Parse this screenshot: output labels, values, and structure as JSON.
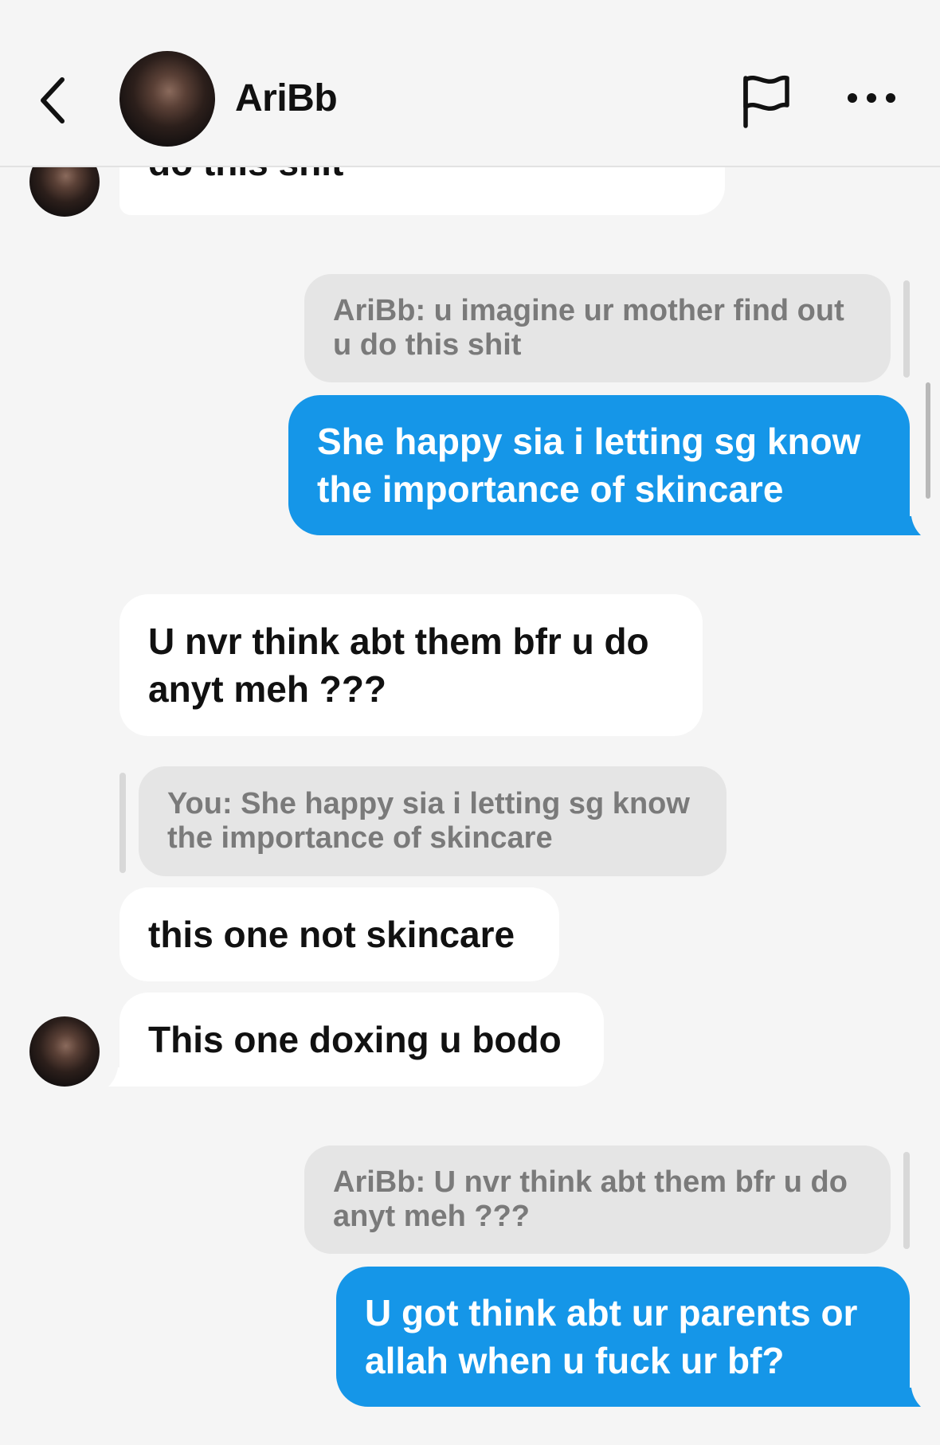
{
  "header": {
    "contact_name": "AriBb",
    "back_icon": "chevron-left-icon",
    "report_icon": "flag-icon",
    "more_icon": "ellipsis-icon"
  },
  "messages": [
    {
      "type": "incoming",
      "text": "do this shit"
    },
    {
      "type": "reply_preview",
      "side": "right",
      "text": "AriBb: u imagine ur mother find out u do this shit"
    },
    {
      "type": "outgoing",
      "text": "She happy sia i letting sg know the importance of skincare"
    },
    {
      "type": "incoming",
      "text": "U nvr think abt them bfr u do anyt meh ???"
    },
    {
      "type": "reply_preview",
      "side": "left",
      "text": "You: She happy sia i letting sg know the importance of skincare"
    },
    {
      "type": "incoming",
      "text": "this one not skincare"
    },
    {
      "type": "incoming",
      "text": "This one doxing u bodo"
    },
    {
      "type": "reply_preview",
      "side": "right",
      "text": "AriBb: U nvr think abt them bfr u do anyt meh ???"
    },
    {
      "type": "outgoing",
      "text": "U got think abt ur parents or allah when u fuck ur bf?"
    }
  ],
  "colors": {
    "background": "#f5f5f5",
    "outgoing_bubble": "#1596e8",
    "incoming_bubble": "#ffffff",
    "reply_preview_bg": "#e5e5e5",
    "reply_preview_text": "#7a7a7a"
  }
}
